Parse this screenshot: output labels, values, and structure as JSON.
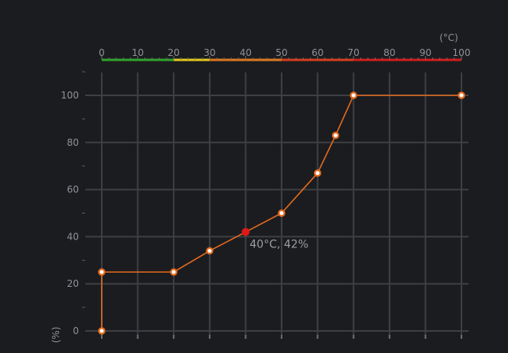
{
  "temperature_axis": {
    "unit_label": "(°C)",
    "ticks": [
      0,
      10,
      20,
      30,
      40,
      50,
      60,
      70,
      80,
      90,
      100
    ],
    "range": [
      0,
      100
    ],
    "color_zones": [
      {
        "from": 0,
        "to": 20,
        "color": "#2ea52a"
      },
      {
        "from": 20,
        "to": 30,
        "color": "#e6c81e"
      },
      {
        "from": 30,
        "to": 50,
        "color": "#e0781c"
      },
      {
        "from": 50,
        "to": 70,
        "color": "#d83c1c"
      },
      {
        "from": 70,
        "to": 100,
        "color": "#d41c1c"
      }
    ]
  },
  "fan_axis": {
    "unit_label": "(%)",
    "ticks": [
      0,
      20,
      40,
      60,
      80,
      100
    ],
    "range": [
      0,
      100
    ]
  },
  "curve": {
    "color": "#e36a1e",
    "points": [
      {
        "t": 0,
        "p": 0
      },
      {
        "t": 0,
        "p": 25
      },
      {
        "t": 20,
        "p": 25
      },
      {
        "t": 30,
        "p": 34
      },
      {
        "t": 40,
        "p": 42
      },
      {
        "t": 50,
        "p": 50
      },
      {
        "t": 60,
        "p": 67
      },
      {
        "t": 65,
        "p": 83
      },
      {
        "t": 70,
        "p": 100
      },
      {
        "t": 100,
        "p": 100
      }
    ]
  },
  "current": {
    "t": 40,
    "p": 42,
    "label": "40°C, 42%",
    "color": "#e01818"
  }
}
